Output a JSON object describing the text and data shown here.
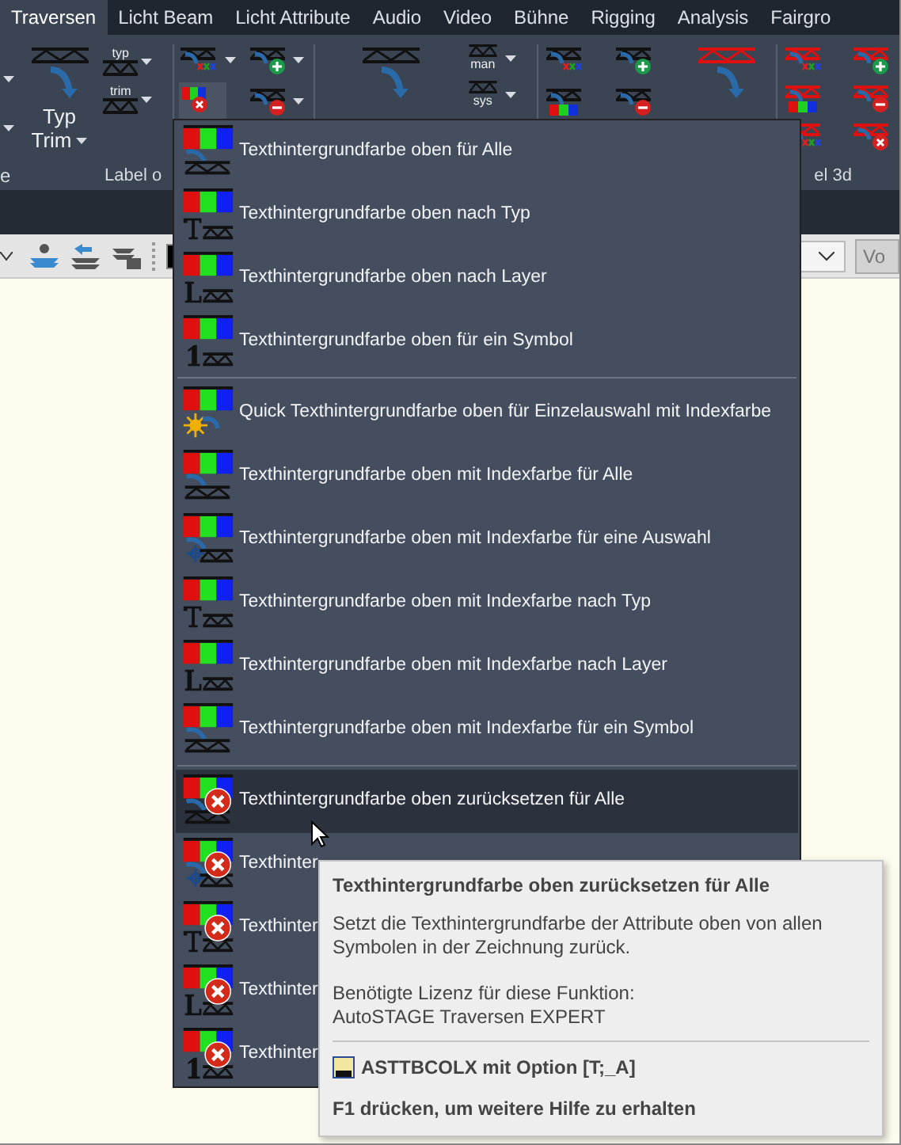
{
  "tabs": [
    {
      "label": "Traversen",
      "selected": true
    },
    {
      "label": "Licht Beam",
      "selected": false
    },
    {
      "label": "Licht Attribute",
      "selected": false
    },
    {
      "label": "Audio",
      "selected": false
    },
    {
      "label": "Video",
      "selected": false
    },
    {
      "label": "Bühne",
      "selected": false
    },
    {
      "label": "Rigging",
      "selected": false
    },
    {
      "label": "Analysis",
      "selected": false
    },
    {
      "label": "Fairgro",
      "selected": false
    }
  ],
  "ribbon": {
    "large_button": {
      "line_1": "Typ",
      "line_2": "Trim"
    },
    "small_labels": [
      "typ",
      "trim",
      "man",
      "sys"
    ],
    "panel_labels": [
      "e",
      "Label o",
      "el 3d"
    ]
  },
  "toolbar": {
    "button": "Vo"
  },
  "menu": {
    "groups": [
      [
        {
          "kind": "all",
          "reset": false,
          "label": "Texthintergrundfarbe oben für Alle",
          "selected": false
        },
        {
          "kind": "typ",
          "reset": false,
          "label": "Texthintergrundfarbe oben nach Typ",
          "selected": false
        },
        {
          "kind": "layer",
          "reset": false,
          "label": "Texthintergrundfarbe oben nach Layer",
          "selected": false
        },
        {
          "kind": "symbol",
          "reset": false,
          "label": "Texthintergrundfarbe oben für ein Symbol",
          "selected": false
        }
      ],
      [
        {
          "kind": "quick",
          "reset": false,
          "label": "Quick Texthintergrundfarbe oben für Einzelauswahl mit Indexfarbe",
          "selected": false
        },
        {
          "kind": "all",
          "reset": false,
          "label": "Texthintergrundfarbe oben mit Indexfarbe für Alle",
          "selected": false
        },
        {
          "kind": "selection",
          "reset": false,
          "label": "Texthintergrundfarbe oben mit Indexfarbe für eine Auswahl",
          "selected": false
        },
        {
          "kind": "typ",
          "reset": false,
          "label": "Texthintergrundfarbe oben mit Indexfarbe nach Typ",
          "selected": false
        },
        {
          "kind": "layer",
          "reset": false,
          "label": "Texthintergrundfarbe oben mit Indexfarbe nach Layer",
          "selected": false
        },
        {
          "kind": "all",
          "reset": false,
          "label": "Texthintergrundfarbe oben mit Indexfarbe für ein Symbol",
          "selected": false
        }
      ],
      [
        {
          "kind": "all",
          "reset": true,
          "label": "Texthintergrundfarbe oben zurücksetzen für Alle",
          "selected": true
        },
        {
          "kind": "selection",
          "reset": true,
          "label": "Texthinter",
          "selected": false
        },
        {
          "kind": "typ",
          "reset": true,
          "label": "Texthinter",
          "selected": false
        },
        {
          "kind": "layer",
          "reset": true,
          "label": "Texthinter",
          "selected": false
        },
        {
          "kind": "symbol",
          "reset": true,
          "label": "Texthinter",
          "selected": false
        }
      ]
    ]
  },
  "tooltip": {
    "title": "Texthintergrundfarbe oben zurücksetzen für Alle",
    "description": "Setzt die Texthintergrundfarbe der Attribute oben von allen Symbolen in der Zeichnung zurück.",
    "license_label": "Benötigte Lizenz für diese Funktion:",
    "license_value": "AutoSTAGE Traversen EXPERT",
    "command": "ASTTBCOLX mit Option [T;_A]",
    "help": "F1 drücken, um weitere Hilfe zu erhalten"
  }
}
